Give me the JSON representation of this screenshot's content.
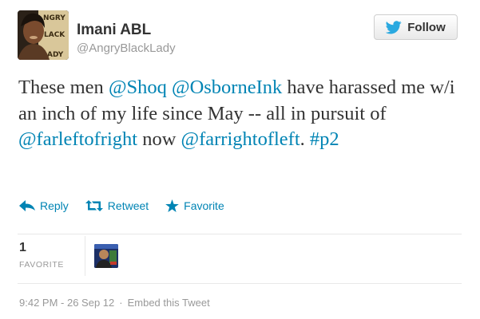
{
  "author": {
    "name": "Imani ABL",
    "handle": "@AngryBlackLady",
    "avatar_text": "ANGRY BLACK LADY"
  },
  "follow_button": {
    "label": "Follow",
    "icon": "twitter-bird-icon",
    "color": "#2aa9e0"
  },
  "tweet": {
    "segments": [
      {
        "text": "These men ",
        "link": false
      },
      {
        "text": "@Shoq",
        "link": true
      },
      {
        "text": " ",
        "link": false
      },
      {
        "text": "@OsborneInk",
        "link": true
      },
      {
        "text": " have harassed me w/i an inch of my life since May -- all in pursuit of ",
        "link": false
      },
      {
        "text": "@farleftofright",
        "link": true
      },
      {
        "text": " now ",
        "link": false
      },
      {
        "text": "@farrightofleft",
        "link": true
      },
      {
        "text": ". ",
        "link": false
      },
      {
        "text": "#p2",
        "link": true
      }
    ],
    "link_color": "#0084b4"
  },
  "actions": [
    {
      "label": "Reply",
      "icon": "reply-icon"
    },
    {
      "label": "Retweet",
      "icon": "retweet-icon"
    },
    {
      "label": "Favorite",
      "icon": "star-icon"
    }
  ],
  "stats": {
    "favorites_count": "1",
    "favorites_label": "FAVORITE"
  },
  "footer": {
    "timestamp": "9:42 PM - 26 Sep 12",
    "separator": "·",
    "embed_label": "Embed this Tweet"
  }
}
